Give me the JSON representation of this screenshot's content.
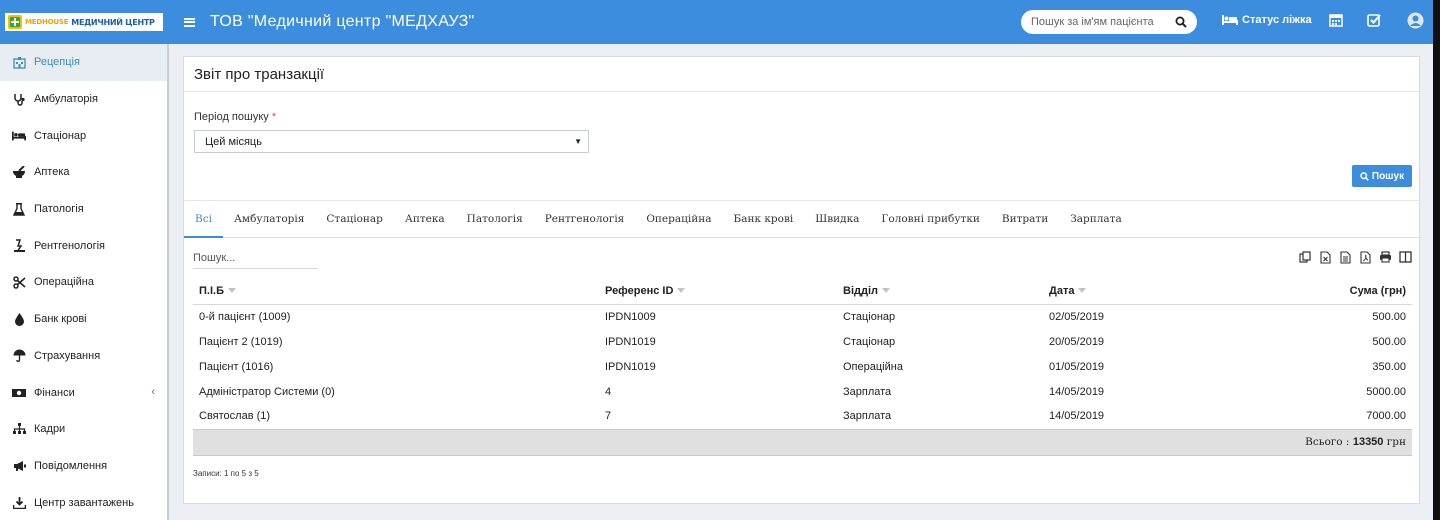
{
  "header": {
    "logo_brand": "MEDHOUSE",
    "logo_name": "МЕДИЧНИЙ ЦЕНТР",
    "app_title": "ТОВ \"Медичний центр \"МЕДХАУЗ\"",
    "patient_search_placeholder": "Пошук за ім'ям пацієнта",
    "bed_status_label": "Статус ліжка",
    "accent_color": "#3c8dde"
  },
  "sidebar": {
    "items": [
      {
        "label": "Рецепція",
        "icon": "hospital-icon",
        "active": true
      },
      {
        "label": "Амбулаторія",
        "icon": "stethoscope-icon"
      },
      {
        "label": "Стаціонар",
        "icon": "bed-icon"
      },
      {
        "label": "Аптека",
        "icon": "mortar-pestle-icon"
      },
      {
        "label": "Патологія",
        "icon": "flask-icon"
      },
      {
        "label": "Рентгенологія",
        "icon": "xray-icon"
      },
      {
        "label": "Операційна",
        "icon": "scissors-icon"
      },
      {
        "label": "Банк крові",
        "icon": "blood-drop-icon"
      },
      {
        "label": "Страхування",
        "icon": "umbrella-icon"
      },
      {
        "label": "Фінанси",
        "icon": "money-icon",
        "has_submenu": true
      },
      {
        "label": "Кадри",
        "icon": "org-chart-icon"
      },
      {
        "label": "Повідомлення",
        "icon": "megaphone-icon"
      },
      {
        "label": "Центр завантажень",
        "icon": "download-icon"
      }
    ]
  },
  "report": {
    "title": "Звіт про транзакції",
    "period_label": "Період пошуку",
    "period_required_mark": "*",
    "period_value": "Цей місяць",
    "search_button_label": "Пошук",
    "tabs": [
      "Всі",
      "Амбулаторія",
      "Стаціонар",
      "Аптека",
      "Патологія",
      "Рентгенологія",
      "Операційна",
      "Банк крові",
      "Швидка",
      "Головні прибутки",
      "Витрати",
      "Зарплата"
    ],
    "active_tab": "Всі",
    "table_search_placeholder": "Пошук...",
    "export_buttons": [
      "copy-icon",
      "excel-icon",
      "csv-icon",
      "pdf-icon",
      "print-icon",
      "columns-icon"
    ],
    "columns": [
      "П.І.Б",
      "Референс ID",
      "Відділ",
      "Дата",
      "Сума (грн)"
    ],
    "rows": [
      [
        "0-й пацієнт (1009)",
        "IPDN1009",
        "Стаціонар",
        "02/05/2019",
        "500.00"
      ],
      [
        "Пацієнт 2 (1019)",
        "IPDN1019",
        "Стаціонар",
        "20/05/2019",
        "500.00"
      ],
      [
        "Пацієнт (1016)",
        "IPDN1019",
        "Операційна",
        "01/05/2019",
        "350.00"
      ],
      [
        "Адміністратор Системи (0)",
        "4",
        "Зарплата",
        "14/05/2019",
        "5000.00"
      ],
      [
        "Святослав (1)",
        "7",
        "Зарплата",
        "14/05/2019",
        "7000.00"
      ]
    ],
    "total_label": "Всього :",
    "total_value": "13350",
    "total_unit": "грн",
    "records_info": "Записи: 1 по 5 з 5"
  }
}
